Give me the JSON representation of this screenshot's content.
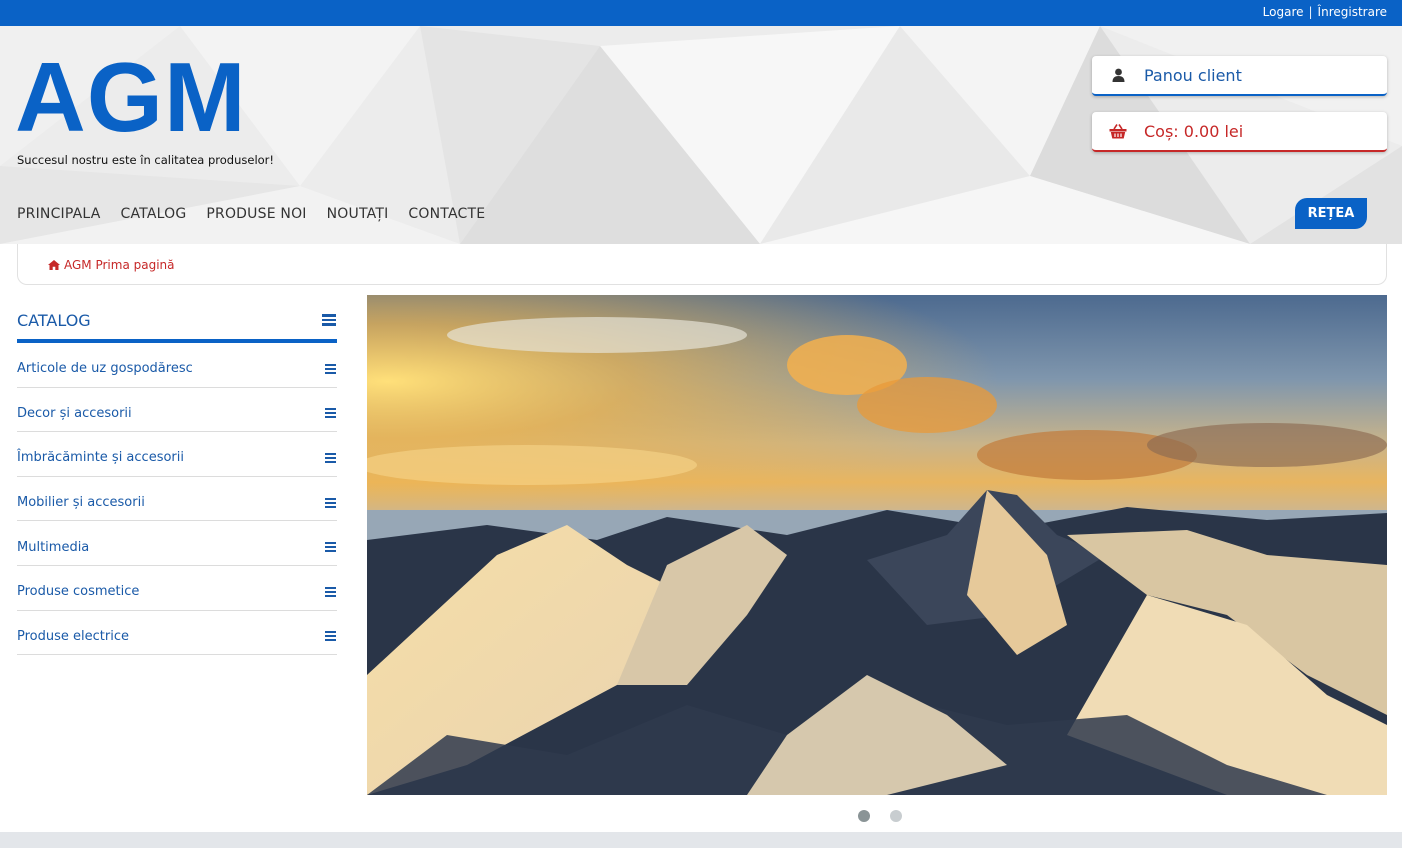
{
  "topbar": {
    "login": "Logare",
    "separator": "|",
    "register": "Înregistrare"
  },
  "header": {
    "logo": "AGM",
    "slogan": "Succesul nostru este în calitatea produselor!",
    "client_panel": "Panou client",
    "cart": "Coș: 0.00 lei",
    "retea": "REȚEA"
  },
  "nav": [
    "PRINCIPALA",
    "CATALOG",
    "PRODUSE NOI",
    "NOUTAȚI",
    "CONTACTE"
  ],
  "breadcrumb": {
    "home": "AGM Prima pagină"
  },
  "catalog": {
    "title": "CATALOG",
    "items": [
      "Articole de uz gospodăresc",
      "Decor și accesorii",
      "Îmbrăcăminte și accesorii",
      "Mobilier și accesorii",
      "Multimedia",
      "Produse cosmetice",
      "Produse electrice"
    ]
  },
  "slider": {
    "slide_count": 2,
    "active_slide": 1
  },
  "colors": {
    "brand_blue": "#0a62c6",
    "cart_red": "#c62828",
    "link_blue": "#1a5aa8"
  }
}
